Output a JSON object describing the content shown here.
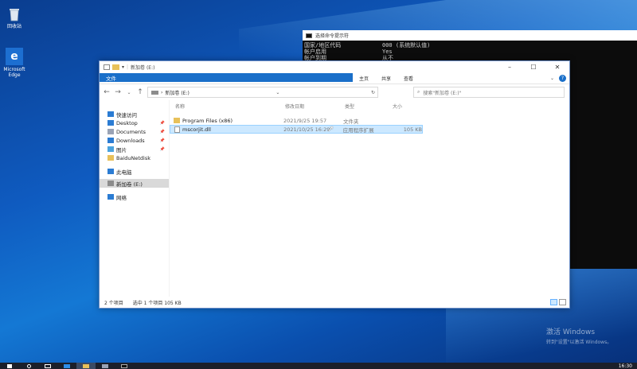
{
  "desktop": {
    "icons": [
      {
        "label": "回收站",
        "icon": "recycle-bin-icon"
      },
      {
        "label": "Microsoft Edge",
        "icon": "edge-icon"
      }
    ],
    "activate": {
      "line1": "激活 Windows",
      "line2": "转到\"设置\"以激活 Windows。"
    }
  },
  "cmd": {
    "title": "选择命令提示符",
    "lines": [
      {
        "k": "国家/地区代码",
        "v": "000 (系统默认值)"
      },
      {
        "k": "帐户启用",
        "v": "Yes"
      },
      {
        "k": "帐户到期",
        "v": "从不"
      }
    ]
  },
  "explorer": {
    "title": "新加卷 (E:)",
    "ribbon_tabs": [
      "文件",
      "主页",
      "共享",
      "查看"
    ],
    "path_root": "新加卷 (E:)",
    "search_placeholder": "搜索\"新加卷 (E:)\"",
    "nav": [
      {
        "label": "快速访问",
        "icon": "star-icon",
        "pinned": false
      },
      {
        "label": "Desktop",
        "icon": "desktop-icon",
        "pinned": true
      },
      {
        "label": "Documents",
        "icon": "documents-icon",
        "pinned": true
      },
      {
        "label": "Downloads",
        "icon": "downloads-icon",
        "pinned": true
      },
      {
        "label": "图片",
        "icon": "pictures-icon",
        "pinned": true
      },
      {
        "label": "BaiduNetdisk",
        "icon": "folder-icon",
        "pinned": false
      },
      {
        "label": "此电脑",
        "icon": "this-pc-icon",
        "pinned": false
      },
      {
        "label": "新加卷 (E:)",
        "icon": "drive-icon",
        "pinned": false
      },
      {
        "label": "网络",
        "icon": "network-icon",
        "pinned": false
      }
    ],
    "columns": {
      "name": "名称",
      "date": "修改日期",
      "type": "类型",
      "size": "大小"
    },
    "files": [
      {
        "name": "Program Files (x86)",
        "date": "2021/9/25 19:57",
        "type": "文件夹",
        "size": "",
        "icon": "folder-icon"
      },
      {
        "name": "mscorjit.dll",
        "date": "2021/10/25 16:29",
        "type": "应用程序扩展",
        "size": "105 KB",
        "icon": "dll-file-icon"
      }
    ],
    "status": {
      "count": "2 个项目",
      "selected": "选中 1 个项目  105 KB"
    }
  },
  "taskbar": {
    "time": "16:30"
  }
}
